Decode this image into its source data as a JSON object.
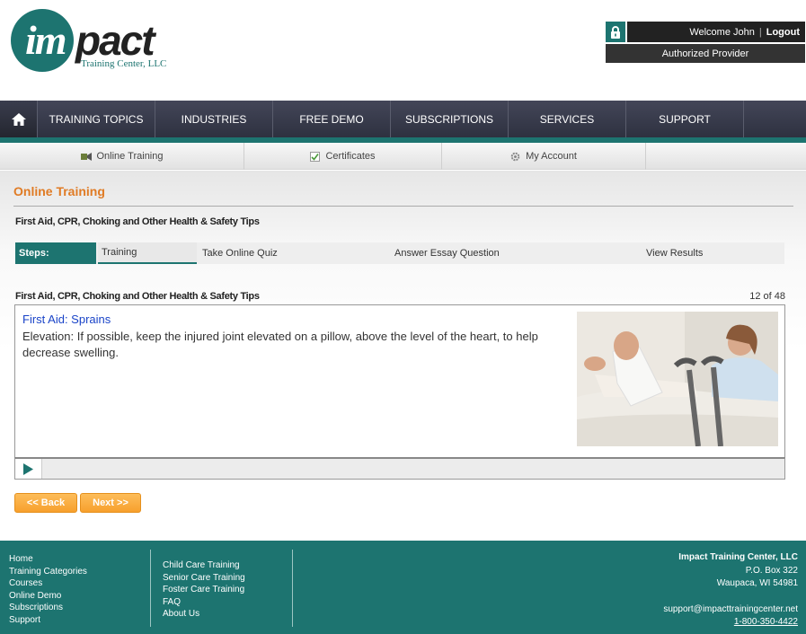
{
  "header": {
    "logo": {
      "main": "impact",
      "sub": "Training Center, LLC"
    },
    "user": {
      "welcome": "Welcome John",
      "separator": "|",
      "logout": "Logout",
      "provider": "Authorized Provider"
    }
  },
  "main_nav": [
    "TRAINING TOPICS",
    "INDUSTRIES",
    "FREE DEMO",
    "SUBSCRIPTIONS",
    "SERVICES",
    "SUPPORT"
  ],
  "sub_nav": [
    {
      "label": "Online Training",
      "icon": "training-icon"
    },
    {
      "label": "Certificates",
      "icon": "certificate-icon"
    },
    {
      "label": "My Account",
      "icon": "gear-icon"
    }
  ],
  "page": {
    "title": "Online Training",
    "course_title": "First Aid, CPR, Choking and Other Health & Safety Tips"
  },
  "steps": {
    "label": "Steps:",
    "items": [
      "Training",
      "Take Online Quiz",
      "Answer Essay Question",
      "View Results"
    ],
    "active": "Training"
  },
  "slide": {
    "section_title": "First Aid, CPR, Choking and Other Health & Safety Tips",
    "counter": "12 of 48",
    "heading": "First Aid: Sprains",
    "text": "Elevation: If possible, keep the injured joint elevated on a pillow, above the level of the heart, to help decrease swelling."
  },
  "buttons": {
    "back": "<< Back",
    "next": "Next >>"
  },
  "footer": {
    "col1": [
      "Home",
      "Training Categories",
      "Courses",
      "Online Demo",
      "Subscriptions",
      "Support"
    ],
    "col2": [
      "Child Care Training",
      "Senior Care Training",
      "Foster Care Training",
      "FAQ",
      "About Us"
    ],
    "company": "Impact Training Center, LLC",
    "address1": "P.O. Box 322",
    "address2": "Waupaca, WI 54981",
    "email": "support@impacttrainingcenter.net",
    "phone": "1-800-350-4422"
  },
  "colors": {
    "teal": "#1d7470",
    "orange": "#e07b24",
    "button": "#f7a02d",
    "nav": "#343746"
  }
}
